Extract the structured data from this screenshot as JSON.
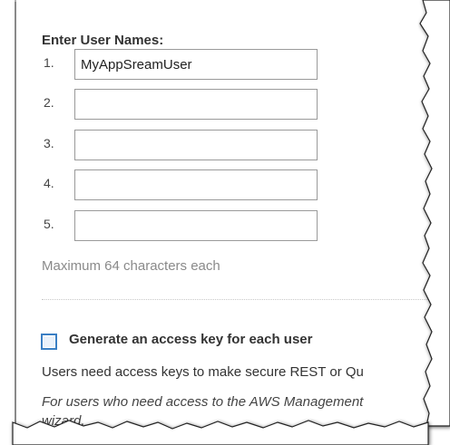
{
  "form": {
    "section_title": "Enter User Names:",
    "rows": [
      {
        "number": "1.",
        "value": "MyAppSreamUser"
      },
      {
        "number": "2.",
        "value": ""
      },
      {
        "number": "3.",
        "value": ""
      },
      {
        "number": "4.",
        "value": ""
      },
      {
        "number": "5.",
        "value": ""
      }
    ],
    "max_hint": "Maximum 64 characters each"
  },
  "access_key": {
    "checkbox_checked": false,
    "checkbox_label": "Generate an access key for each user",
    "description": "Users need access keys to make secure REST or Qu",
    "italic_note_line1": "For users who need access to the AWS Management",
    "italic_note_line2": "wizard."
  },
  "colors": {
    "checkbox_border": "#3a7fc4",
    "hint_text": "#8a8a8a"
  }
}
